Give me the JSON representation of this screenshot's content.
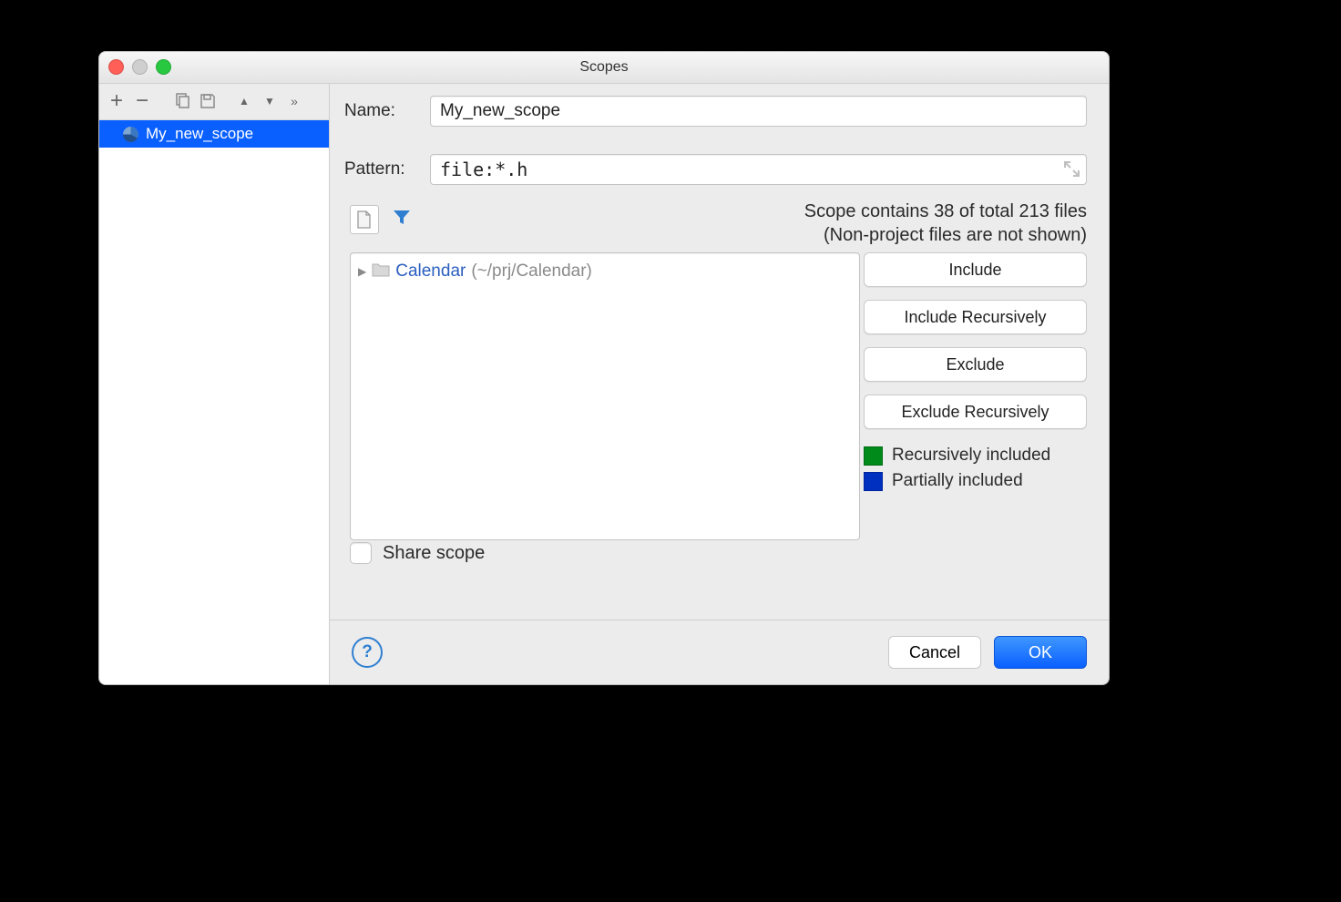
{
  "window": {
    "title": "Scopes"
  },
  "sidebar": {
    "items": [
      {
        "label": "My_new_scope",
        "selected": true
      }
    ]
  },
  "main": {
    "name_label": "Name:",
    "name_value": "My_new_scope",
    "pattern_label": "Pattern:",
    "pattern_value": "file:*.h",
    "stats_line1": "Scope contains 38 of total 213 files",
    "stats_line2": "(Non-project files are not shown)",
    "stats": {
      "contained": 38,
      "total": 213
    },
    "tree": [
      {
        "name": "Calendar",
        "path": "(~/prj/Calendar)"
      }
    ],
    "buttons": {
      "include": "Include",
      "include_rec": "Include Recursively",
      "exclude": "Exclude",
      "exclude_rec": "Exclude Recursively"
    },
    "legend": {
      "recursive": "Recursively included",
      "partial": "Partially included",
      "colors": {
        "recursive": "#008a1a",
        "partial": "#0030c0"
      }
    },
    "share_label": "Share scope",
    "share_checked": false
  },
  "footer": {
    "cancel": "Cancel",
    "ok": "OK"
  }
}
